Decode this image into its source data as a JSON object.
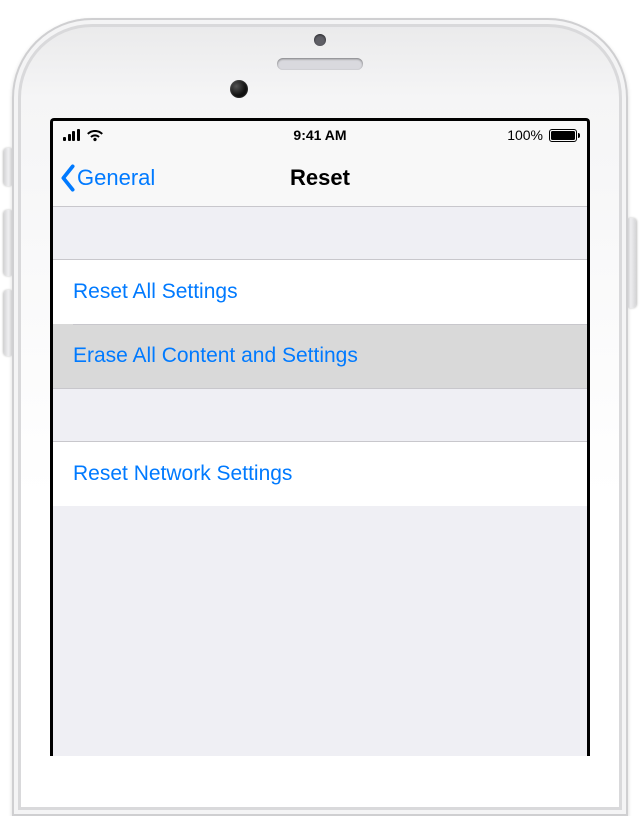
{
  "status": {
    "time": "9:41 AM",
    "battery_pct": "100%"
  },
  "nav": {
    "back_label": "General",
    "title": "Reset"
  },
  "rows": {
    "reset_all": "Reset All Settings",
    "erase_all": "Erase All Content and Settings",
    "reset_network": "Reset Network Settings"
  }
}
